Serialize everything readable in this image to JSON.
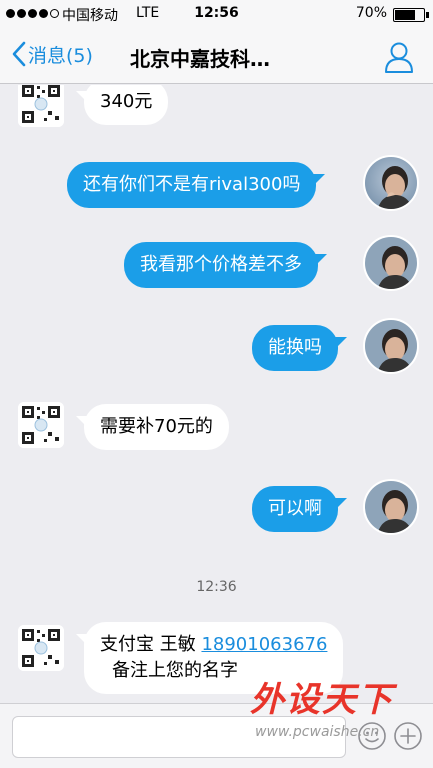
{
  "status_bar": {
    "carrier": "中国移动",
    "network": "LTE",
    "time": "12:56",
    "battery_percent": "70%",
    "battery_level": 0.7,
    "signal_bars": 4
  },
  "nav": {
    "back_label": "消息(5)",
    "title": "北京中嘉技科…",
    "icons": {
      "back": "chevron-left-icon",
      "profile": "person-icon"
    }
  },
  "messages": [
    {
      "side": "in",
      "text": "340元"
    },
    {
      "side": "out",
      "text": "还有你们不是有rival300吗"
    },
    {
      "side": "out",
      "text": "我看那个价格差不多"
    },
    {
      "side": "out",
      "text": "能换吗"
    },
    {
      "side": "in",
      "text": "需要补70元的"
    },
    {
      "side": "out",
      "text": "可以啊"
    },
    {
      "side": "in",
      "line1_prefix": "支付宝 王敏 ",
      "phone": "18901063676",
      "line2": "备注上您的名字"
    }
  ],
  "timestamp": "12:36",
  "input_bar": {
    "icons": {
      "emoji": "emoji-icon",
      "plus": "plus-icon"
    }
  },
  "watermark": {
    "title": "外设天下",
    "url": "www.pcwaishe.cn"
  },
  "colors": {
    "accent": "#1a8ddd",
    "bubble_out": "#1b9ee8",
    "bubble_in": "#ffffff",
    "background": "#ededf1",
    "watermark": "#e8342a"
  }
}
